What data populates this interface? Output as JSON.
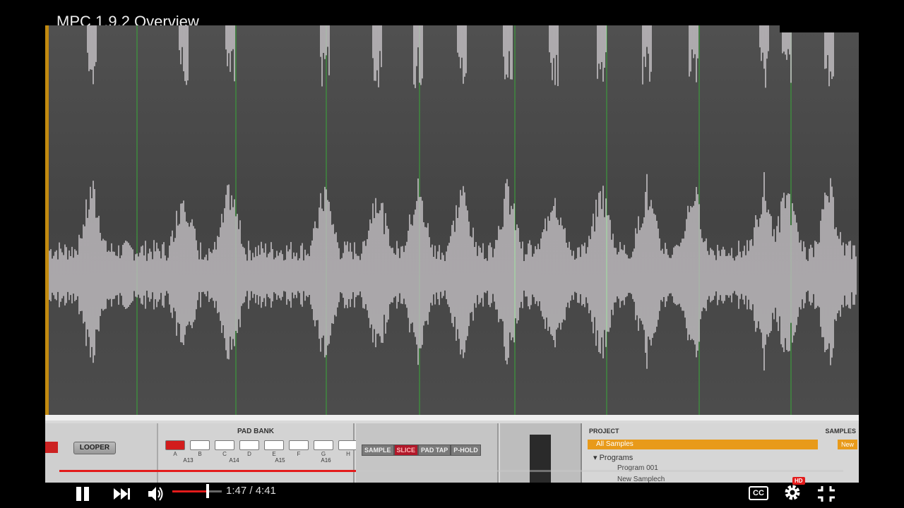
{
  "video": {
    "title": "MPC 1.9.2 Overview",
    "progress_fraction": 0.378
  },
  "player": {
    "time": "1:47 / 4:41",
    "volume_fraction": 0.7,
    "cc_label": "CC",
    "hd_badge": "HD",
    "icons": [
      "pause-icon",
      "next-icon",
      "volume-icon",
      "gear-icon",
      "exit-fullscreen-icon"
    ]
  },
  "mpc": {
    "looper_label": "LOOPER",
    "padbank_title": "PAD BANK",
    "pad_letters": [
      "A",
      "B",
      "C",
      "D",
      "E",
      "F",
      "G",
      "H"
    ],
    "active_pad_index": 0,
    "pad_numbers": [
      "A13",
      "A14",
      "A15",
      "A16"
    ],
    "modes": [
      "SAMPLE",
      "SLICE",
      "PAD TAP",
      "P-HOLD"
    ],
    "selected_mode": "SLICE",
    "project_header": "PROJECT",
    "samples_header": "SAMPLES",
    "all_samples": "All Samples",
    "new_label": "New",
    "programs_label": "Programs",
    "program_items": [
      "Program 001",
      "New Samplech"
    ]
  },
  "colors": {
    "progress": "#e31b1b",
    "orange": "#e89a1a",
    "waveform": "#f0ecf0",
    "gridline": "#3c9a3c"
  }
}
